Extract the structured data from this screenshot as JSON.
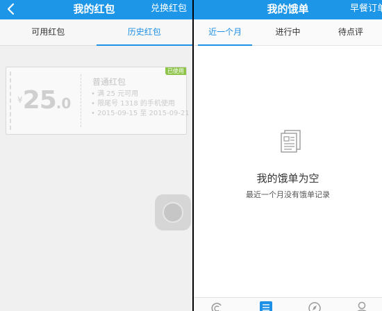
{
  "left": {
    "nav": {
      "title": "我的红包",
      "action": "兑换红包",
      "back_icon": "chevron-left-icon"
    },
    "tabs": [
      {
        "label": "可用红包",
        "active": false
      },
      {
        "label": "历史红包",
        "active": true
      }
    ],
    "coupon": {
      "currency": "¥",
      "amount_int": "25",
      "amount_dec": ".0",
      "title": "普通红包",
      "status_badge": "已使用",
      "rules": [
        "满 25 元可用",
        "限尾号 1318 的手机使用",
        "2015-09-15 至 2015-09-21"
      ]
    },
    "assistive_touch_icon": "assistive-touch-icon"
  },
  "right": {
    "nav": {
      "title": "我的饿单",
      "action": "早餐订单"
    },
    "tabs": [
      {
        "label": "近一个月",
        "active": true
      },
      {
        "label": "进行中",
        "active": false
      },
      {
        "label": "待点评",
        "active": false
      }
    ],
    "empty": {
      "icon": "document-icon",
      "title": "我的饿单为空",
      "subtitle": "最近一个月没有饿单记录"
    },
    "tabbar_icons": [
      "eleme-logo-icon",
      "order-list-icon",
      "compass-icon",
      "profile-icon"
    ]
  },
  "colors": {
    "brand_blue": "#1e96e8",
    "tab_active": "#1e90e6",
    "badge_green": "#8ec44a",
    "page_bg": "#f0f0f0"
  }
}
